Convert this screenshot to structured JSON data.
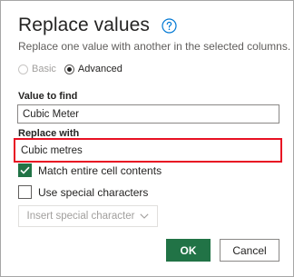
{
  "dialog": {
    "title": "Replace values",
    "subtitle": "Replace one value with another in the selected columns.",
    "help_icon": "question-circle-icon",
    "mode": {
      "options": [
        {
          "label": "Basic",
          "selected": false,
          "enabled": false
        },
        {
          "label": "Advanced",
          "selected": true,
          "enabled": true
        }
      ]
    },
    "value_to_find": {
      "label": "Value to find",
      "value": "Cubic Meter"
    },
    "replace_with": {
      "label": "Replace with",
      "value": "Cubic metres"
    },
    "match_entire": {
      "label": "Match entire cell contents",
      "checked": true
    },
    "use_special": {
      "label": "Use special characters",
      "checked": false
    },
    "insert_special": {
      "label": "Insert special character",
      "enabled": false,
      "icon": "chevron-down-icon"
    },
    "ok_label": "OK",
    "cancel_label": "Cancel"
  },
  "colors": {
    "accent": "#217346",
    "help": "#0078d4",
    "highlight": "#e81123"
  }
}
